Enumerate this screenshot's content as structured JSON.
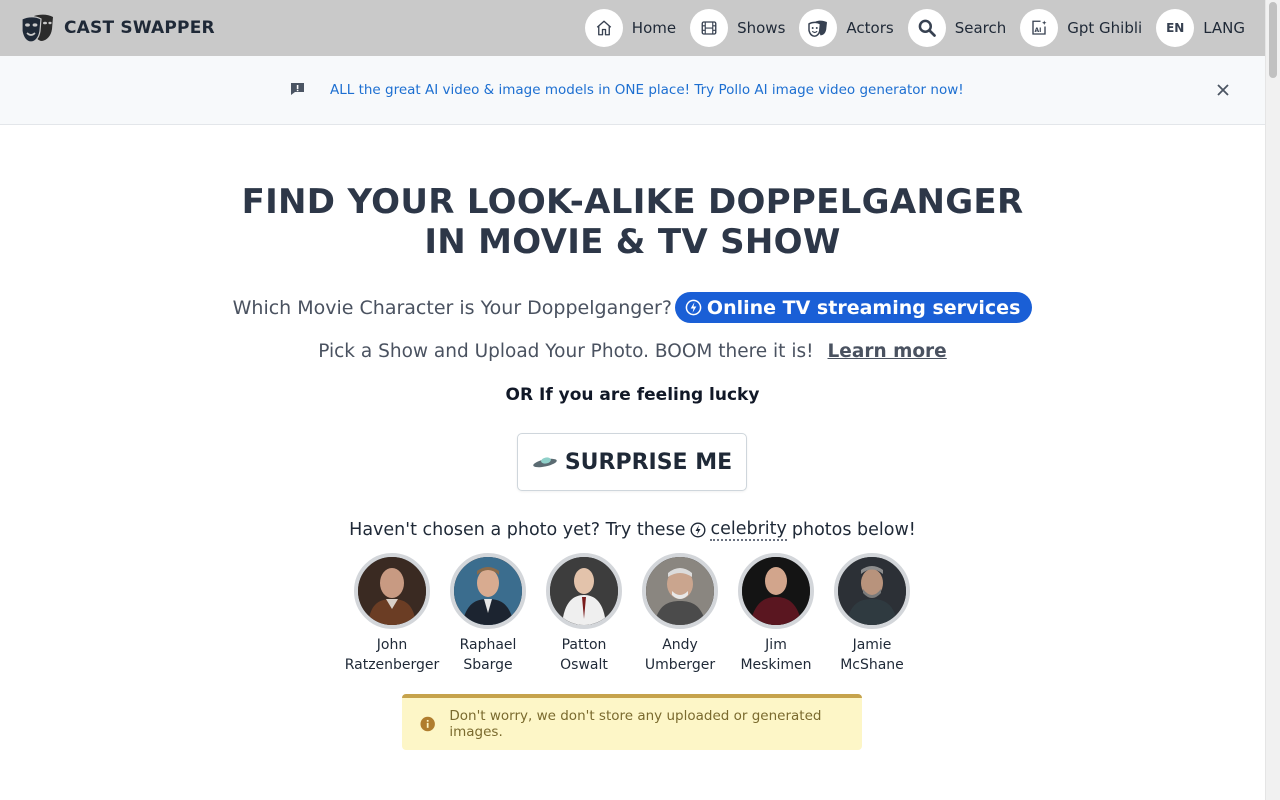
{
  "header": {
    "brand": "CAST SWAPPER",
    "nav": [
      {
        "label": "Home",
        "icon": "home-icon"
      },
      {
        "label": "Shows",
        "icon": "film-icon"
      },
      {
        "label": "Actors",
        "icon": "masks-icon"
      },
      {
        "label": "Search",
        "icon": "search-icon"
      },
      {
        "label": "Gpt Ghibli",
        "icon": "ai-image-icon"
      },
      {
        "label": "LANG",
        "icon_text": "EN"
      }
    ]
  },
  "banner": {
    "text": "ALL the great AI video & image models in ONE place! Try Pollo AI image video generator now!"
  },
  "main": {
    "title_line1": "FIND YOUR LOOK-ALIKE DOPPELGANGER",
    "title_line2": "IN MOVIE & TV SHOW",
    "which_text": "Which Movie Character is Your Doppelganger?",
    "streaming_label": "Online TV streaming services",
    "pick_text": "Pick a Show and Upload Your Photo. BOOM there it is!",
    "learn_more": "Learn more",
    "lucky_text": "OR If you are feeling lucky",
    "surprise_label": "SURPRISE ME",
    "celeb_prefix": "Haven't chosen a photo yet? Try these",
    "celeb_word": "celebrity",
    "celeb_suffix": "photos below!",
    "celebrities": [
      {
        "first": "John",
        "last": "Ratzenberger"
      },
      {
        "first": "Raphael",
        "last": "Sbarge"
      },
      {
        "first": "Patton",
        "last": "Oswalt"
      },
      {
        "first": "Andy",
        "last": "Umberger"
      },
      {
        "first": "Jim",
        "last": "Meskimen"
      },
      {
        "first": "Jamie",
        "last": "McShane"
      }
    ],
    "notice": "Don't worry, we don't store any uploaded or generated images."
  },
  "colors": {
    "navbar": "#c9c9c9",
    "link_blue": "#1d6fd1",
    "pill_blue": "#1a5fd6",
    "notice_bg": "#fdf6c7",
    "notice_border": "#c6a34c"
  }
}
